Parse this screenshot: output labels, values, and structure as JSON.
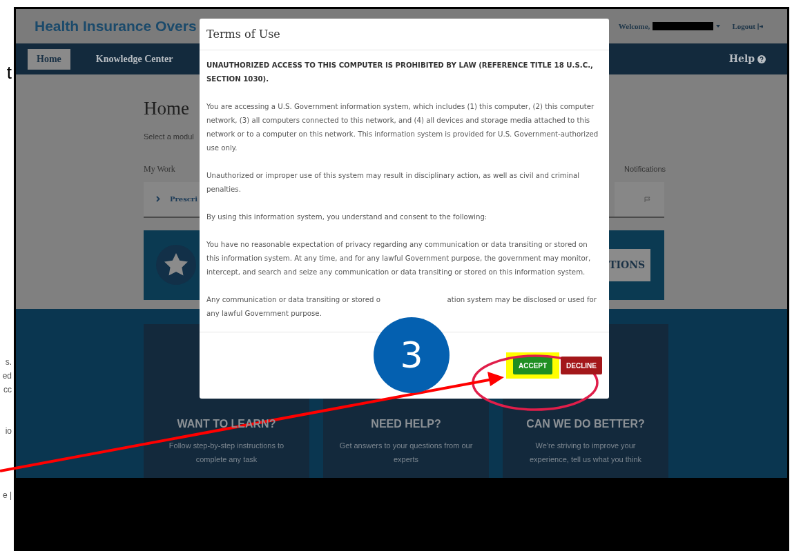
{
  "margin_fragments": [
    "t",
    "s.",
    "ed",
    "cc",
    "io",
    "e |"
  ],
  "header": {
    "title": "Health Insurance Overs",
    "welcome": "Welcome,",
    "logout": "Logout"
  },
  "nav": {
    "tabs": [
      {
        "label": "Home",
        "selected": true
      },
      {
        "label": "Knowledge Center",
        "selected": false
      }
    ],
    "help": "Help"
  },
  "page": {
    "title": "Home",
    "subtitle": "Select a modul",
    "my_work": {
      "heading": "My Work",
      "items": [
        "Prescri"
      ]
    },
    "notifications": {
      "heading": "Notifications"
    },
    "banner": {
      "button": "TIONS"
    },
    "cards": [
      {
        "title": "WANT TO LEARN?",
        "text": "Follow step-by-step instructions to complete any task"
      },
      {
        "title": "NEED HELP?",
        "text": "Get answers to your questions from our experts"
      },
      {
        "title": "CAN WE DO BETTER?",
        "text": "We're striving to improve your experience, tell us what you think"
      }
    ]
  },
  "modal": {
    "title": "Terms of Use",
    "warning": "UNAUTHORIZED ACCESS TO THIS COMPUTER IS PROHIBITED BY LAW (REFERENCE TITLE 18 U.S.C., SECTION 1030).",
    "paragraphs": [
      "You are accessing a U.S. Government information system, which includes (1) this computer, (2) this computer network, (3) all computers connected to this network, and (4) all devices and storage media attached to this network or to a computer on this network. This information system is provided for U.S. Government-authorized use only.",
      "Unauthorized or improper use of this system may result in disciplinary action, as well as civil and criminal penalties.",
      "By using this information system, you understand and consent to the following:",
      "You have no reasonable expectation of privacy regarding any communication or data transiting or stored on this information system. At any time, and for any lawful Government purpose, the government may monitor, intercept, and search and seize any communication or data transiting or stored on this information system."
    ],
    "last_paragraph": {
      "before": "Any communication or data transiting or stored o",
      "after": "ation system may be disclosed or used for",
      "line2": "any lawful Government purpose."
    },
    "accept": "ACCEPT",
    "decline": "DECLINE"
  },
  "annotation": {
    "step": "3"
  }
}
